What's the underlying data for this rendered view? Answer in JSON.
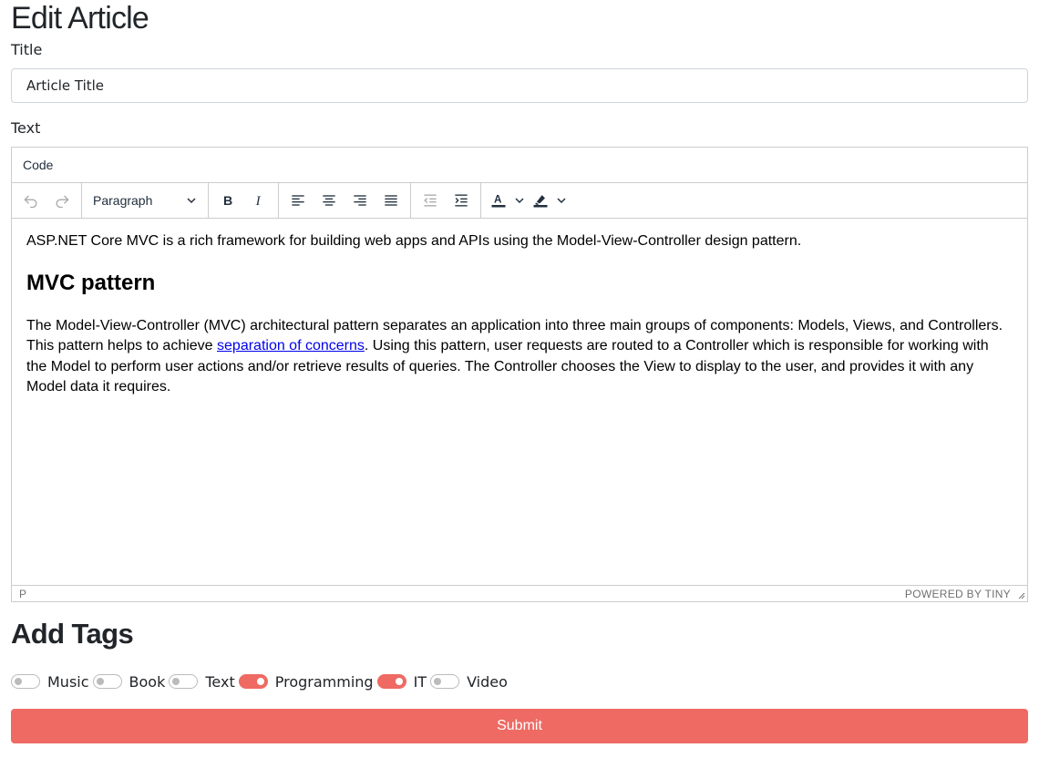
{
  "page": {
    "title": "Edit Article"
  },
  "form": {
    "title_label": "Title",
    "title_value": "Article Title",
    "text_label": "Text"
  },
  "editor": {
    "menu": [
      "Code"
    ],
    "block_format": "Paragraph",
    "content": {
      "intro": "ASP.NET Core MVC is a rich framework for building web apps and APIs using the Model-View-Controller design pattern.",
      "heading": "MVC pattern",
      "body_before_link": "The Model-View-Controller (MVC) architectural pattern separates an application into three main groups of components: Models, Views, and Controllers. This pattern helps to achieve ",
      "link_text": "separation of concerns",
      "body_after_link": ". Using this pattern, user requests are routed to a Controller which is responsible for working with the Model to perform user actions and/or retrieve results of queries. The Controller chooses the View to display to the user, and provides it with any Model data it requires."
    },
    "status_path": "P",
    "powered_by": "POWERED BY TINY",
    "icons": [
      "undo-icon",
      "redo-icon",
      "bold-icon",
      "italic-icon",
      "align-left-icon",
      "align-center-icon",
      "align-right-icon",
      "align-justify-icon",
      "outdent-icon",
      "indent-icon",
      "text-color-icon",
      "highlight-color-icon"
    ]
  },
  "tags": {
    "title": "Add Tags",
    "items": [
      {
        "label": "Music",
        "checked": false
      },
      {
        "label": "Book",
        "checked": false
      },
      {
        "label": "Text",
        "checked": false
      },
      {
        "label": "Programming",
        "checked": true
      },
      {
        "label": "IT",
        "checked": true
      },
      {
        "label": "Video",
        "checked": false
      }
    ]
  },
  "submit_label": "Submit",
  "colors": {
    "accent": "#ee6a63",
    "text_color_swatch": "#222f3e"
  }
}
